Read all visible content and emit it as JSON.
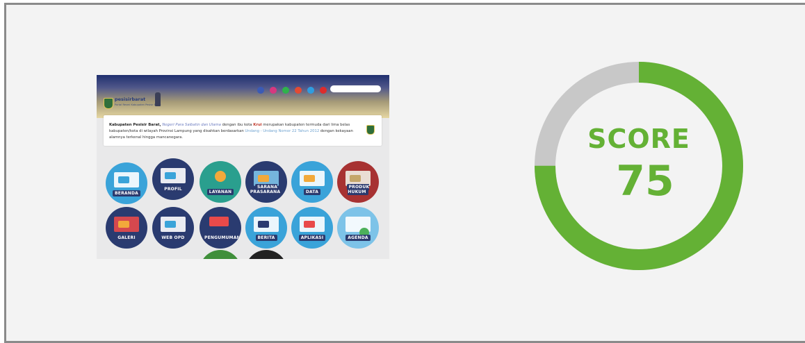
{
  "thumbnail": {
    "site_name": "pesisirbarat",
    "site_tagline": "Portal Resmi Kabupaten Pesisir Barat",
    "social_icons": [
      "facebook-icon",
      "instagram-icon",
      "whatsapp-icon",
      "mail-icon",
      "twitter-icon",
      "youtube-icon"
    ],
    "intro": {
      "bold": "Kabupaten Pesisir Barat,",
      "italic": "Negeri Para Saibatin dan Ulama",
      "text1": "dengan ibu kota",
      "capital": "Krui",
      "text2": "merupakan kabupaten termuda dari lima belas kabupaten/kota di wilayah Provinsi Lampung yang disahkan berdasarkan",
      "law_link": "Undang - Undang Nomor 22 Tahun 2012",
      "text3": "dengan kekayaan alamnya terkenal hingga mancanegara."
    },
    "tiles": [
      "BERANDA",
      "PROFIL",
      "LAYANAN",
      "SARANA PRASARANA",
      "DATA",
      "PRODUK HUKUM",
      "GALERI",
      "WEB OPD",
      "PENGUMUMAN",
      "BERITA",
      "APLIKASI",
      "AGENDA"
    ]
  },
  "score": {
    "label": "SCORE",
    "value": "75",
    "percent": 75,
    "color": "#64b135",
    "track_color": "#c8c8c8"
  }
}
